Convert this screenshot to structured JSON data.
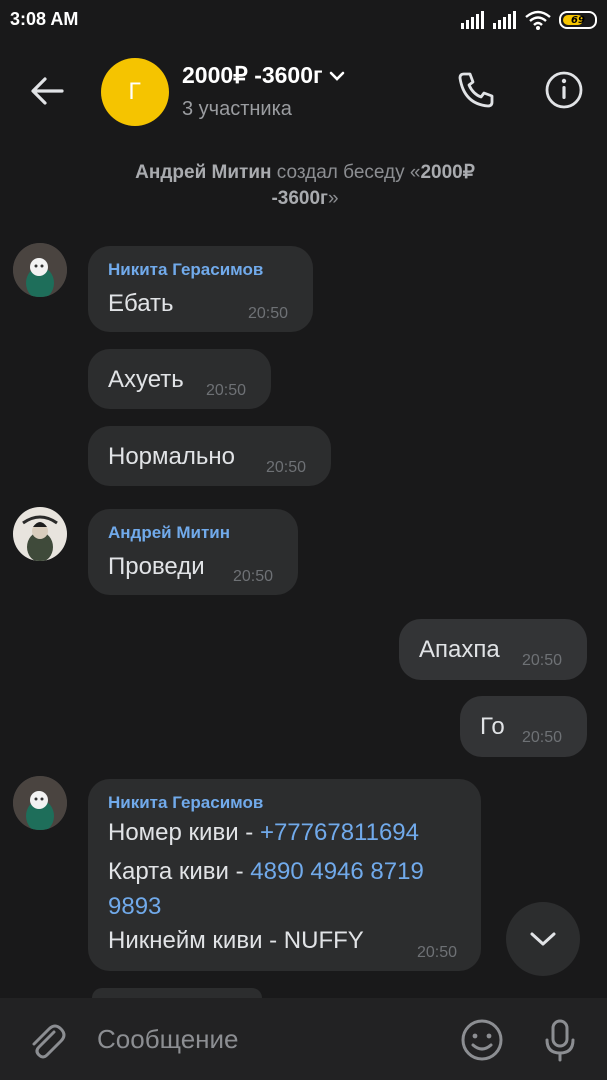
{
  "status_bar": {
    "time": "3:08 AM",
    "battery": "69"
  },
  "header": {
    "avatar_letter": "Г",
    "avatar_color": "#f5c400",
    "title": "2000₽ -3600г",
    "subtitle": "3 участника"
  },
  "system_message": {
    "author": "Андрей Митин",
    "action": " создал беседу «",
    "chat": "2000₽ -3600г",
    "close": "»"
  },
  "messages": [
    {
      "author": "Никита Герасимов",
      "text": "Ебать",
      "time": "20:50"
    },
    {
      "text": "Ахуеть",
      "time": "20:50"
    },
    {
      "text": "Нормально",
      "time": "20:50"
    },
    {
      "author": "Андрей Митин",
      "text": "Проведи",
      "time": "20:50"
    },
    {
      "text": "Апахпа",
      "time": "20:50",
      "outgoing": true
    },
    {
      "text": "Го",
      "time": "20:50",
      "outgoing": true
    },
    {
      "author": "Никита Герасимов",
      "line1_label": "Номер киви - ",
      "line1_link": "+77767811694",
      "line2_label": "Карта киви - ",
      "line2_link": "4890 4946 8719 9893",
      "line3": "Никнейм киви - NUFFY",
      "time": "20:50"
    }
  ],
  "composer": {
    "placeholder": "Сообщение"
  },
  "colors": {
    "accent_link": "#71aaeb",
    "background": "#19191a",
    "bubble": "#2c2d2e"
  },
  "icons": [
    "back-arrow-icon",
    "chevron-down-icon",
    "phone-icon",
    "info-icon",
    "chevron-down-icon",
    "paperclip-icon",
    "smile-icon",
    "microphone-icon"
  ]
}
